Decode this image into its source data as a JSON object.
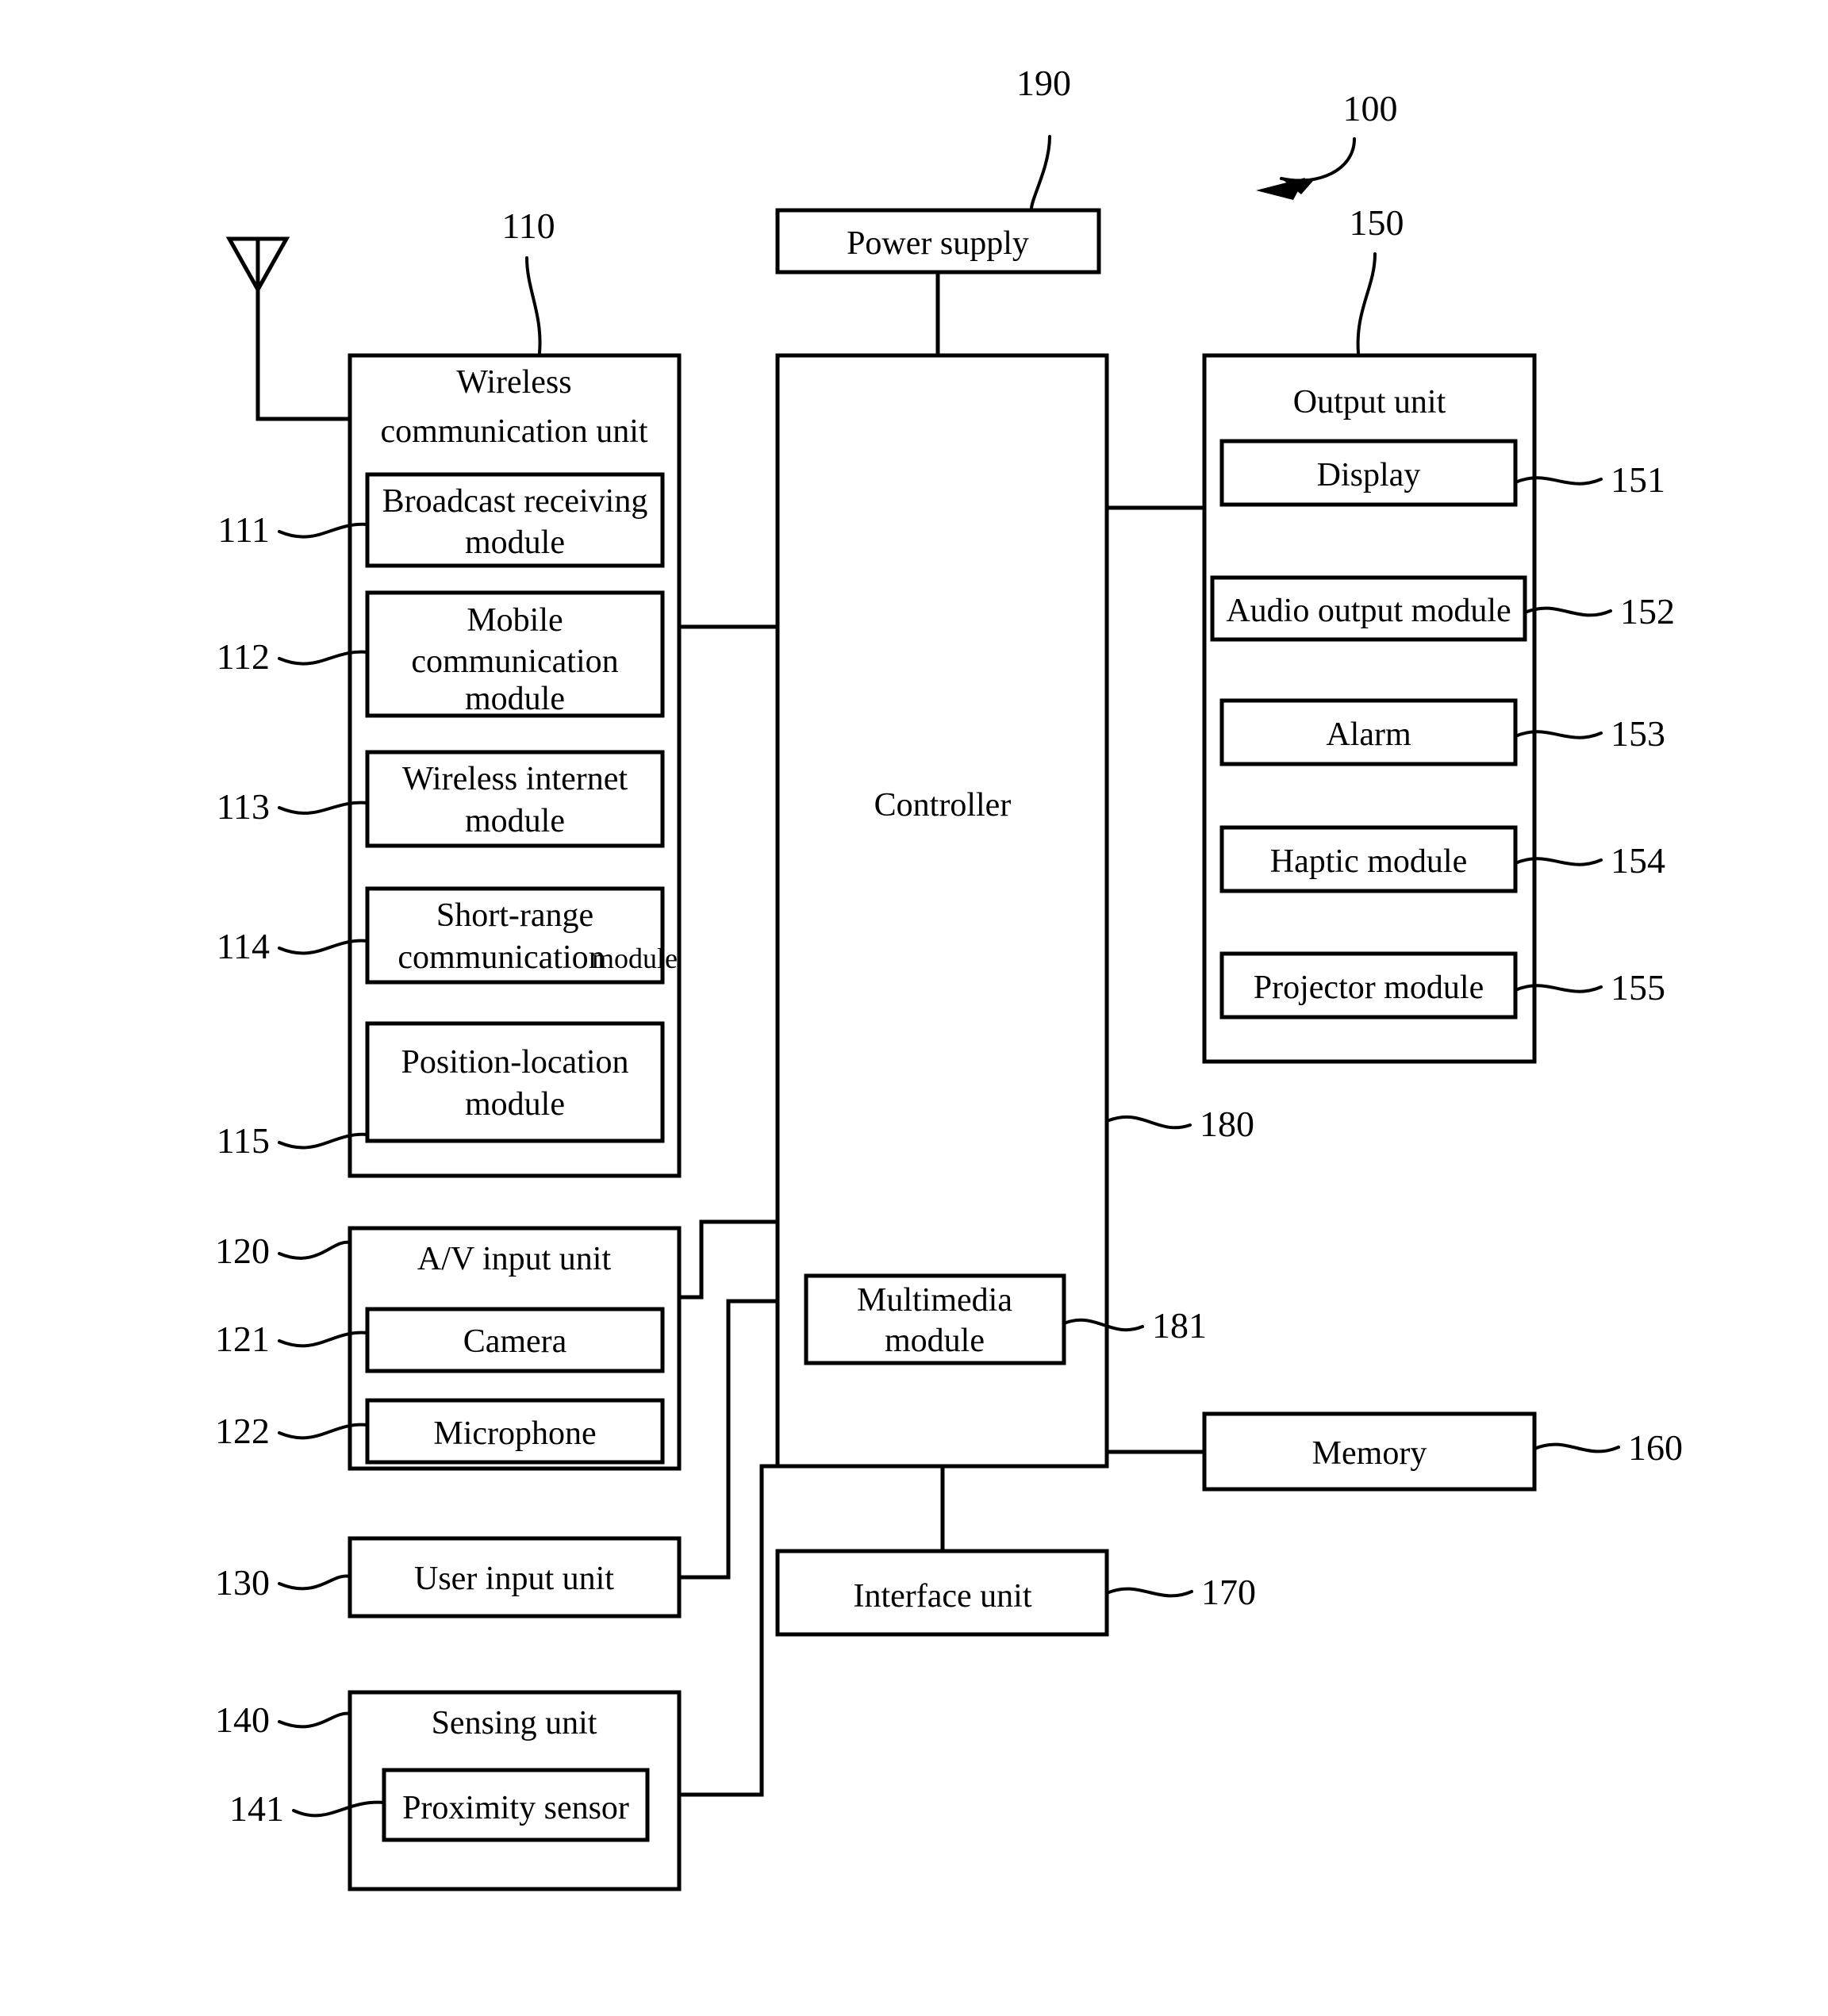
{
  "figure": {
    "type": "patent-block-diagram",
    "title_ref": "100",
    "background": "#ffffff",
    "line_color": "#000000"
  },
  "blocks": {
    "power_supply": {
      "label": "Power supply",
      "ref": "190"
    },
    "system": {
      "ref": "100"
    },
    "wireless_unit": {
      "label_line1": "Wireless",
      "label_line2": "communication unit",
      "ref": "110",
      "modules": [
        {
          "ref": "111",
          "label_line1": "Broadcast receiving",
          "label_line2": "module"
        },
        {
          "ref": "112",
          "label_line1": "Mobile",
          "label_line2": "communication",
          "label_line3": "module"
        },
        {
          "ref": "113",
          "label_line1": "Wireless internet",
          "label_line2": "module"
        },
        {
          "ref": "114",
          "label_line1": "Short-range",
          "label_line2": "communication",
          "label_line2b": "module"
        },
        {
          "ref": "115",
          "label_line1": "Position-location",
          "label_line2": "module"
        }
      ]
    },
    "controller": {
      "label": "Controller",
      "ref": "180"
    },
    "multimedia_module": {
      "label_line1": "Multimedia",
      "label_line2": "module",
      "ref": "181"
    },
    "output_unit": {
      "label": "Output unit",
      "ref": "150",
      "modules": [
        {
          "ref": "151",
          "label": "Display"
        },
        {
          "ref": "152",
          "label": "Audio output module"
        },
        {
          "ref": "153",
          "label": "Alarm"
        },
        {
          "ref": "154",
          "label": "Haptic module"
        },
        {
          "ref": "155",
          "label": "Projector module"
        }
      ]
    },
    "av_input_unit": {
      "label": "A/V input unit",
      "ref": "120",
      "modules": [
        {
          "ref": "121",
          "label": "Camera"
        },
        {
          "ref": "122",
          "label": "Microphone"
        }
      ]
    },
    "user_input_unit": {
      "label": "User input unit",
      "ref": "130"
    },
    "sensing_unit": {
      "label": "Sensing unit",
      "ref": "140",
      "modules": [
        {
          "ref": "141",
          "label": "Proximity sensor"
        }
      ]
    },
    "memory": {
      "label": "Memory",
      "ref": "160"
    },
    "interface_unit": {
      "label": "Interface unit",
      "ref": "170"
    }
  }
}
